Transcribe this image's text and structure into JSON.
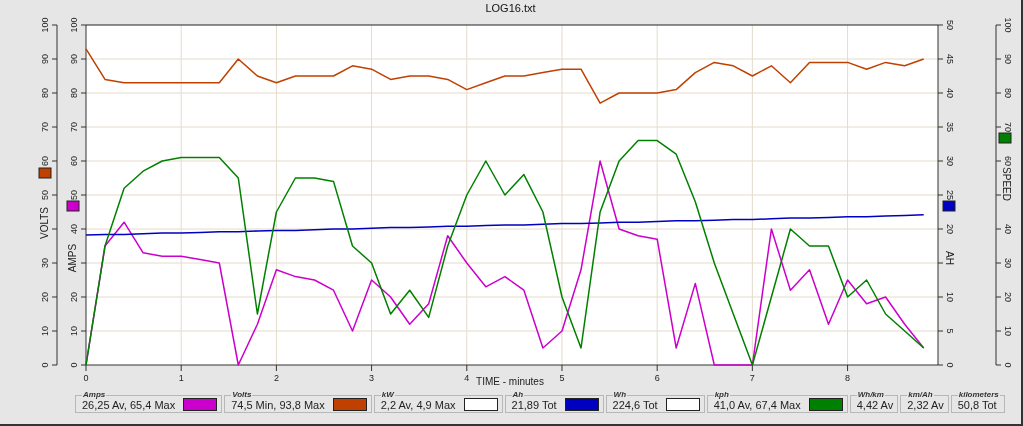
{
  "chart": {
    "left_axes": [
      {
        "title": "VOLTS",
        "color": "#c04000",
        "ticks": [
          "0",
          "10",
          "20",
          "30",
          "50",
          "60",
          "70",
          "80",
          "90",
          "100"
        ]
      },
      {
        "title": "AMPS",
        "color": "#cc00cc"
      }
    ],
    "right_axes": [
      {
        "title": "AH",
        "color": "#0000c0"
      },
      {
        "title": "SPEED",
        "color": "#008000",
        "ticks": [
          "0",
          "10",
          "20",
          "30",
          "40",
          "60",
          "70",
          "80",
          "90",
          "100"
        ]
      }
    ],
    "chart_data": {
      "type": "line",
      "title": "LOG16.txt",
      "xlabel": "TIME - minutes",
      "xlim": [
        0,
        8.95
      ],
      "ylim": [
        0,
        100
      ],
      "grid": true,
      "xticks": [
        0,
        1,
        2,
        3,
        4,
        5,
        6,
        7,
        8
      ],
      "yticks": [
        0,
        10,
        20,
        40,
        50,
        60,
        70,
        80,
        90,
        100
      ],
      "y2lim": [
        0,
        50
      ],
      "y2ticks": [
        0,
        5,
        10,
        20,
        25,
        30,
        35,
        40,
        45,
        50
      ],
      "x": [
        0,
        0.2,
        0.4,
        0.6,
        0.8,
        1,
        1.2,
        1.4,
        1.6,
        1.8,
        2,
        2.2,
        2.4,
        2.6,
        2.8,
        3,
        3.2,
        3.4,
        3.6,
        3.8,
        4,
        4.2,
        4.4,
        4.6,
        4.8,
        5,
        5.2,
        5.4,
        5.6,
        5.8,
        6,
        6.2,
        6.4,
        6.6,
        6.8,
        7,
        7.2,
        7.4,
        7.6,
        7.8,
        8,
        8.2,
        8.4,
        8.6,
        8.8
      ],
      "series": [
        {
          "color": "#c04000",
          "values": [
            93,
            84,
            83,
            83,
            83,
            83,
            83,
            83,
            90,
            85,
            83,
            85,
            85,
            85,
            88,
            87,
            84,
            85,
            85,
            84,
            81,
            83,
            85,
            85,
            86,
            87,
            87,
            77,
            80,
            80,
            80,
            81,
            86,
            89,
            88,
            85,
            88,
            83,
            89,
            89,
            89,
            87,
            89,
            88,
            90
          ]
        },
        {
          "color": "#cc00cc",
          "values": [
            0,
            35,
            42,
            33,
            32,
            32,
            31,
            30,
            0,
            12,
            28,
            26,
            25,
            22,
            10,
            25,
            20,
            12,
            18,
            38,
            30,
            23,
            26,
            22,
            5,
            10,
            28,
            60,
            40,
            38,
            37,
            5,
            24,
            0,
            0,
            0,
            40,
            22,
            28,
            12,
            25,
            18,
            20,
            12,
            5
          ]
        },
        {
          "color": "#0000c0",
          "axis": "y2",
          "values": [
            19.1,
            19.2,
            19.2,
            19.3,
            19.4,
            19.4,
            19.5,
            19.6,
            19.6,
            19.7,
            19.8,
            19.8,
            19.9,
            20.0,
            20.0,
            20.1,
            20.2,
            20.2,
            20.3,
            20.4,
            20.4,
            20.5,
            20.6,
            20.6,
            20.7,
            20.8,
            20.8,
            20.9,
            21.0,
            21.0,
            21.1,
            21.2,
            21.2,
            21.3,
            21.4,
            21.4,
            21.5,
            21.6,
            21.6,
            21.7,
            21.8,
            21.8,
            21.9,
            22.0,
            22.1
          ]
        },
        {
          "color": "#008000",
          "values": [
            0,
            35,
            52,
            57,
            60,
            61,
            61,
            61,
            55,
            15,
            45,
            55,
            55,
            54,
            35,
            30,
            15,
            22,
            14,
            35,
            50,
            60,
            50,
            56,
            45,
            20,
            5,
            45,
            60,
            66,
            66,
            62,
            48,
            30,
            15,
            0,
            20,
            40,
            35,
            35,
            20,
            25,
            15,
            10,
            5
          ]
        }
      ]
    }
  },
  "legend": [
    {
      "title": "Amps",
      "value": "26,25 Av, 65,4 Max",
      "color": "#cc00cc"
    },
    {
      "title": "Volts",
      "value": "74,5 Min, 93,8 Max",
      "color": "#c04000"
    },
    {
      "title": "kW",
      "value": "2,2 Av, 4,9 Max",
      "color": "#ffffff"
    },
    {
      "title": "Ah",
      "value": "21,89 Tot",
      "color": "#0000c0"
    },
    {
      "title": "Wh",
      "value": "224,6 Tot",
      "color": "#ffffff"
    },
    {
      "title": "kph",
      "value": "41,0 Av, 67,4 Max",
      "color": "#008000"
    },
    {
      "title": "Wh/km",
      "value": "4,42 Av"
    },
    {
      "title": "km/Ah",
      "value": "2,32 Av"
    },
    {
      "title": "kilometers",
      "value": "50,8 Tot"
    }
  ]
}
